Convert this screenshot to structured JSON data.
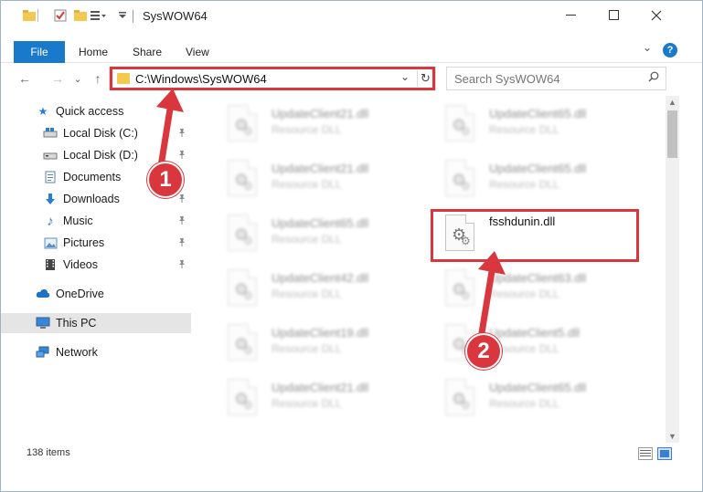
{
  "window": {
    "title": "SysWOW64",
    "minimize": "—",
    "maximize": "☐",
    "close": "✕"
  },
  "ribbon": {
    "tabs": [
      "File",
      "Home",
      "Share",
      "View"
    ],
    "help": "?",
    "collapse": "⌄"
  },
  "nav": {
    "back": "←",
    "forward": "→",
    "recent": "⌄",
    "up": "↑",
    "address": "C:\\Windows\\SysWOW64",
    "address_drop": "⌄",
    "refresh": "↻",
    "search_placeholder": "Search SysWOW64",
    "search_icon_glyph": "⌕"
  },
  "sidebar": {
    "items": [
      {
        "label": "Quick access",
        "icon": "star-icon",
        "glyph": "★",
        "color": "#2a7dd1"
      },
      {
        "label": "Local Disk (C:)",
        "icon": "drive-icon",
        "glyph": "▬",
        "color": "#6b6b6b",
        "pinned": true
      },
      {
        "label": "Local Disk (D:)",
        "icon": "drive-icon",
        "glyph": "▬",
        "color": "#6b6b6b",
        "pinned": true
      },
      {
        "label": "Documents",
        "icon": "documents-icon",
        "glyph": "▤",
        "color": "#5f7fa8",
        "pinned": true
      },
      {
        "label": "Downloads",
        "icon": "download-icon",
        "glyph": "⬇",
        "color": "#2a7dd1",
        "pinned": true
      },
      {
        "label": "Music",
        "icon": "music-icon",
        "glyph": "♪",
        "color": "#2a7dd1",
        "pinned": true
      },
      {
        "label": "Pictures",
        "icon": "pictures-icon",
        "glyph": "▣",
        "color": "#5f8fbf",
        "pinned": true
      },
      {
        "label": "Videos",
        "icon": "videos-icon",
        "glyph": "▦",
        "color": "#444444",
        "pinned": true
      },
      {
        "label": "OneDrive",
        "icon": "cloud-icon",
        "glyph": "☁",
        "color": "#1f6fc5"
      },
      {
        "label": "This PC",
        "icon": "computer-icon",
        "glyph": "▭",
        "color": "#3a86d4",
        "selected": true
      },
      {
        "label": "Network",
        "icon": "network-icon",
        "glyph": "⊞",
        "color": "#3a86d4"
      }
    ],
    "pin_glyph": "📌"
  },
  "files": [
    {
      "name": "UpdateClient21.dll",
      "type": "Resource DLL"
    },
    {
      "name": "UpdateClient65.dll",
      "type": "Resource DLL"
    },
    {
      "name": "UpdateClient21.dll",
      "type": "Resource DLL"
    },
    {
      "name": "UpdateClient65.dll",
      "type": "Resource DLL"
    },
    {
      "name": "UpdateClient65.dll",
      "type": "Resource DLL"
    },
    {
      "name": "fsshdunin.dll",
      "type": ""
    },
    {
      "name": "UpdateClient42.dll",
      "type": "Resource DLL"
    },
    {
      "name": "UpdateClient63.dll",
      "type": "Resource DLL"
    },
    {
      "name": "UpdateClient19.dll",
      "type": "Resource DLL"
    },
    {
      "name": "UpdateClient5.dll",
      "type": "Resource DLL"
    },
    {
      "name": "UpdateClient21.dll",
      "type": "Resource DLL"
    },
    {
      "name": "UpdateClient65.dll",
      "type": "Resource DLL"
    }
  ],
  "status": {
    "items_count": "138 items"
  },
  "annotations": {
    "badge1": "1",
    "badge2": "2",
    "color": "#d9363e"
  }
}
